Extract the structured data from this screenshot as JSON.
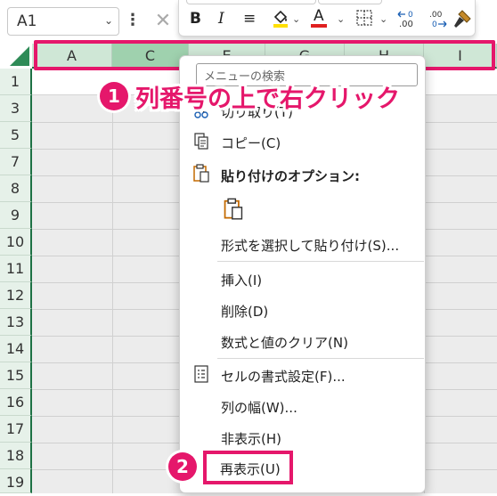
{
  "namebox": {
    "value": "A1"
  },
  "toolbar": {
    "bold": "B",
    "italic": "I",
    "align": "≡",
    "font_color": "A",
    "dec_increase": "←0 .00",
    "dec_decrease": ".00 →0",
    "fill_color_hex": "#ffe000",
    "font_color_hex": "#e02020"
  },
  "columns": [
    "A",
    "C",
    "E",
    "G",
    "H",
    "I"
  ],
  "rows": [
    "1",
    "3",
    "5",
    "7",
    "8",
    "9",
    "10",
    "11",
    "12",
    "13",
    "14",
    "15",
    "16",
    "17",
    "18",
    "19"
  ],
  "menu": {
    "search_placeholder": "メニューの検索",
    "cut": "切り取り(T)",
    "copy": "コピー(C)",
    "paste_options": "貼り付けのオプション:",
    "paste_special": "形式を選択して貼り付け(S)...",
    "insert": "挿入(I)",
    "delete": "削除(D)",
    "clear": "数式と値のクリア(N)",
    "format_cells": "セルの書式設定(F)...",
    "column_width": "列の幅(W)...",
    "hide": "非表示(H)",
    "unhide": "再表示(U)"
  },
  "callouts": {
    "step1_number": "1",
    "step1_text": "列番号の上で右クリック",
    "step2_number": "2"
  },
  "colors": {
    "accent": "#e5176b",
    "header_green": "#cfe7d6",
    "header_selected": "#9fd1ae",
    "grid_gray": "#ececec"
  }
}
